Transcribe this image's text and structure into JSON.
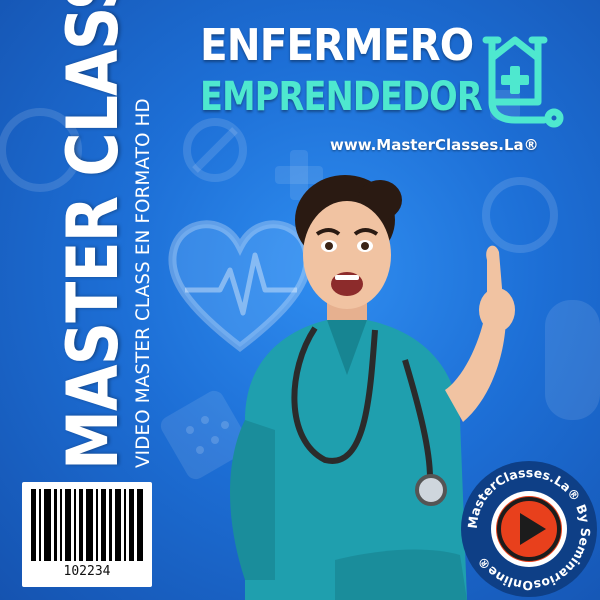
{
  "cover": {
    "vertical_title": "MASTER CLASS",
    "vertical_subtitle": "VIDEO MASTER CLASS EN FORMATO HD",
    "headline_line1": "ENFERMERO",
    "headline_line2": "EMPRENDEDOR",
    "website": "www.MasterClasses.La®",
    "barcode_number": "102234",
    "badge_text": "MasterClasses.La® By SeminariosOnline®"
  },
  "colors": {
    "background": "#1d6fd6",
    "accent_teal": "#4ee8cf",
    "scrubs": "#1f9fae",
    "badge_red": "#e8401c"
  }
}
